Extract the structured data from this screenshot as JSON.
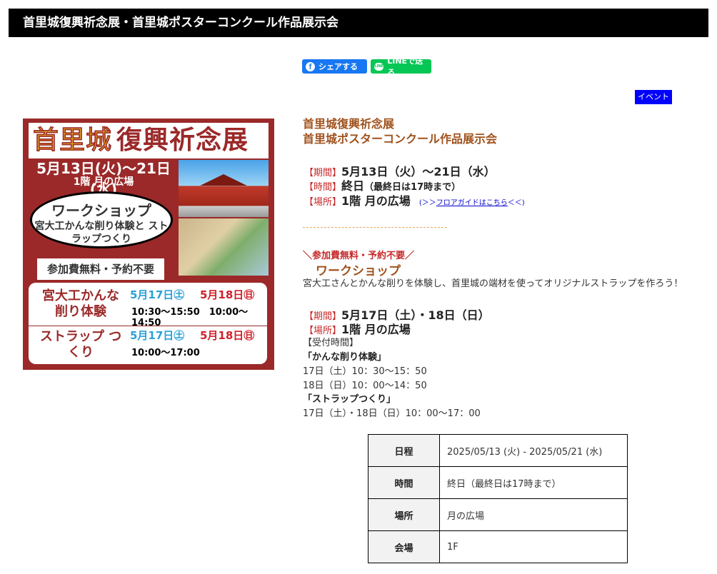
{
  "header": {
    "title": "首里城復興祈念展・首里城ポスターコンクール作品展示会"
  },
  "share": {
    "facebook_label": "シェアする",
    "facebook_glyph": "f",
    "line_label": "LINEで送る",
    "line_glyph": "LINE"
  },
  "tag": {
    "label": "イベント",
    "color": "#0000ff"
  },
  "poster": {
    "title_yellow": "首里城",
    "title_red": "復興祈念展",
    "dates": "5月13日(火)〜21日(水)",
    "place": "1階 月の広場",
    "workshop_title": "ワークショップ",
    "workshop_sub": "宮大工かんな削り体験と ストラップつくり",
    "free": "参加費無料・予約不要",
    "sched": [
      {
        "name": "宮大工かんな 削り体験",
        "d1": "5月17日㊏",
        "d2": "5月18日㊐",
        "times": "10:30〜15:50　10:00〜14:50"
      },
      {
        "name": "ストラップ つくり",
        "d1": "5月17日㊏",
        "d2": "5月18日㊐",
        "times": "10:00〜17:00"
      }
    ]
  },
  "event": {
    "title_line1": "首里城復興祈念展",
    "title_line2": "首里城ポスターコンクール作品展示会",
    "period_label": "【期間】",
    "period_big": "5月13日（火）〜21日（水）",
    "time_label": "【時間】",
    "time_big": "終日",
    "time_small": "（最終日は17時まで）",
    "place_label": "【場所】",
    "place_big": "1階 月の広場",
    "floor_prefix": "(＞＞",
    "floor_link": "フロアガイドはこちら",
    "floor_suffix": "＜＜)",
    "divider": "-------------------------------"
  },
  "workshop": {
    "free": "＼参加費無料・予約不要／",
    "title": "ワークショップ",
    "desc": "宮大工さんとかんな削りを体験し、首里城の端材を使ってオリジナルストラップを作ろう！",
    "period_label": "【期間】",
    "period": "5月17日（土）・18日（日）",
    "place_label": "【場所】",
    "place": "1階 月の広場",
    "reception_label": "【受付時間】",
    "kanna_title": "「かんな削り体験」",
    "kanna_1": "17日（土）10：30〜15：50",
    "kanna_2": "18日（日）10：00〜14：50",
    "strap_title": "「ストラップつくり」",
    "strap_1": "17日（土）・18日（日）10：00〜17：00"
  },
  "table": [
    {
      "label": "日程",
      "value": "2025/05/13 (火) - 2025/05/21 (水)"
    },
    {
      "label": "時間",
      "value": "終日（最終日は17時まで）"
    },
    {
      "label": "場所",
      "value": "月の広場"
    },
    {
      "label": "会場",
      "value": "1F"
    }
  ]
}
